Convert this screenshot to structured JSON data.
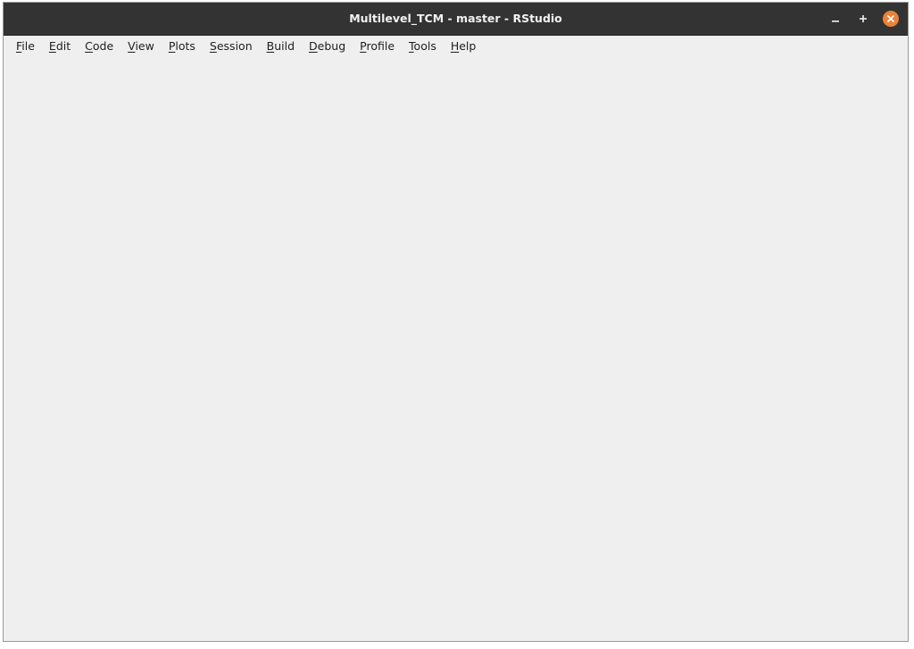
{
  "window": {
    "title": "Multilevel_TCM - master - RStudio",
    "controls": {
      "minimize_icon": "minimize-icon",
      "maximize_icon": "maximize-icon",
      "close_icon": "close-icon",
      "close_color": "#e9823a"
    }
  },
  "menubar": {
    "items": [
      {
        "mnemonic": "F",
        "rest": "ile"
      },
      {
        "mnemonic": "E",
        "rest": "dit"
      },
      {
        "mnemonic": "C",
        "rest": "ode"
      },
      {
        "mnemonic": "V",
        "rest": "iew"
      },
      {
        "mnemonic": "P",
        "rest": "lots"
      },
      {
        "mnemonic": "S",
        "rest": "ession"
      },
      {
        "mnemonic": "B",
        "rest": "uild"
      },
      {
        "mnemonic": "D",
        "rest": "ebug"
      },
      {
        "mnemonic": "P",
        "rest": "rofile"
      },
      {
        "mnemonic": "T",
        "rest": "ools"
      },
      {
        "mnemonic": "H",
        "rest": "elp"
      }
    ]
  },
  "colors": {
    "titlebar": "#333333",
    "window_bg": "#efefef",
    "accent_close": "#e9823a"
  }
}
